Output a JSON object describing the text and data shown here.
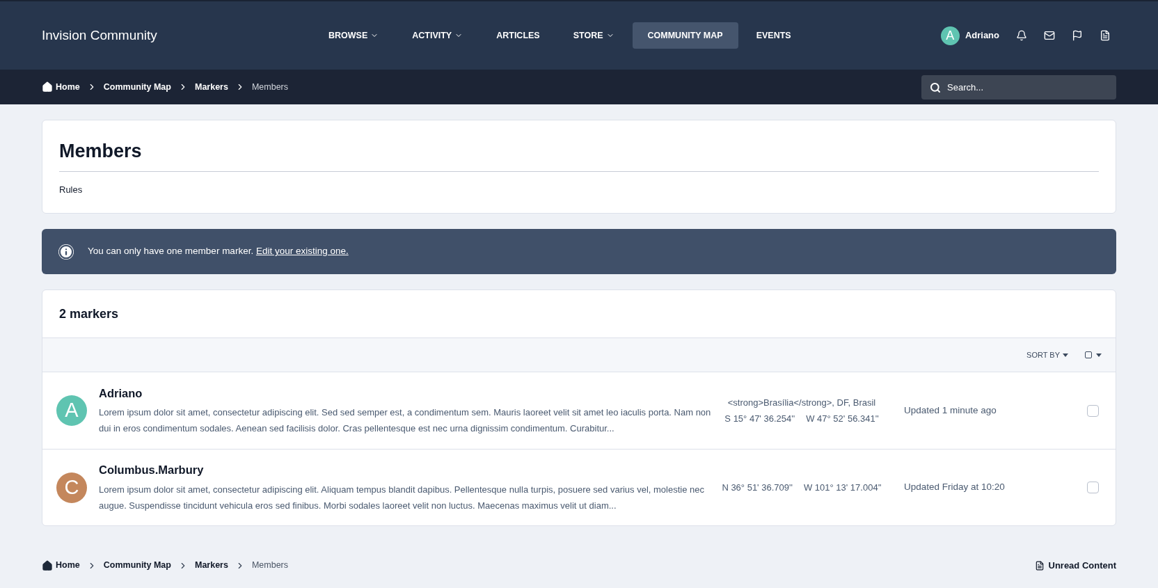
{
  "header": {
    "site_title": "Invision Community",
    "nav": [
      {
        "label": "BROWSE",
        "dropdown": true,
        "selected": false
      },
      {
        "label": "ACTIVITY",
        "dropdown": true,
        "selected": false
      },
      {
        "label": "ARTICLES",
        "dropdown": false,
        "selected": false
      },
      {
        "label": "STORE",
        "dropdown": true,
        "selected": false
      },
      {
        "label": "COMMUNITY MAP",
        "dropdown": false,
        "selected": true
      },
      {
        "label": "EVENTS",
        "dropdown": false,
        "selected": false
      }
    ],
    "user": {
      "avatar_letter": "A",
      "name": "Adriano"
    }
  },
  "breadcrumb": [
    "Home",
    "Community Map",
    "Markers",
    "Members"
  ],
  "search": {
    "placeholder": "Search..."
  },
  "page": {
    "title": "Members",
    "rules_link": "Rules"
  },
  "notice": {
    "text": "You can only have one member marker. ",
    "link": "Edit your existing one."
  },
  "markers_panel": {
    "title": "2 markers",
    "sort_label": "SORT BY",
    "markers": [
      {
        "avatar_letter": "A",
        "color": "#5fc4b1",
        "name": "Adriano",
        "description": "Lorem ipsum dolor sit amet, consectetur adipiscing elit. Sed sed semper est, a condimentum sem. Mauris laoreet velit sit amet leo iaculis porta. Nam non dui in eros condimentum sodales. Aenean sed facilisis dolor. Cras pellentesque est nec urna dignissim condimentum. Curabitur...",
        "address": "<strong>Brasília</strong>, DF, Brasil",
        "coords": [
          "S 15° 47' 36.254''",
          "W 47° 52' 56.341''"
        ],
        "updated": "Updated 1 minute ago",
        "checked": false
      },
      {
        "avatar_letter": "C",
        "color": "#c4875c",
        "name": "Columbus.Marbury",
        "description": "Lorem ipsum dolor sit amet, consectetur adipiscing elit. Aliquam tempus blandit dapibus. Pellentesque nulla turpis, posuere sed varius vel, molestie nec augue. Suspendisse tincidunt vehicula eros sed finibus. Morbi sodales laoreet velit non luctus. Maecenas maximus velit ut diam...",
        "coords": [
          "N 36° 51' 36.709''",
          "W 101° 13' 17.004''"
        ],
        "updated": "Updated Friday at 10:20",
        "checked": false
      }
    ]
  },
  "footer": {
    "breadcrumb": [
      "Home",
      "Community Map",
      "Markers",
      "Members"
    ],
    "unread_link": "Unread Content"
  }
}
